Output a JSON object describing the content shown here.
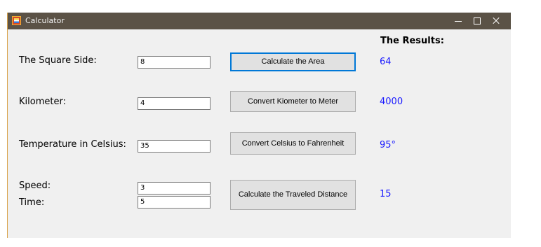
{
  "window": {
    "title": "Calculator",
    "controls": {
      "minimize": "—",
      "maximize": "□",
      "close": "✕"
    }
  },
  "results": {
    "title": "The Results:",
    "area": "64",
    "meters": "4000",
    "fahrenheit": "95°",
    "distance": "15"
  },
  "rows": {
    "square": {
      "label": "The Square Side:",
      "value": "8",
      "button": "Calculate the Area"
    },
    "kilometer": {
      "label": "Kilometer:",
      "value": "4",
      "button": "Convert Kiometer to Meter"
    },
    "temperature": {
      "label": "Temperature in Celsius:",
      "value": "35",
      "button": "Convert Celsius to Fahrenheit"
    },
    "travel": {
      "speed_label": "Speed:",
      "speed_value": "3",
      "time_label": "Time:",
      "time_value": "5",
      "button": "Calculate the Traveled Distance"
    }
  },
  "colors": {
    "titlebar": "#5b5246",
    "result_text": "#1a1aff",
    "focus_border": "#0078d7"
  }
}
